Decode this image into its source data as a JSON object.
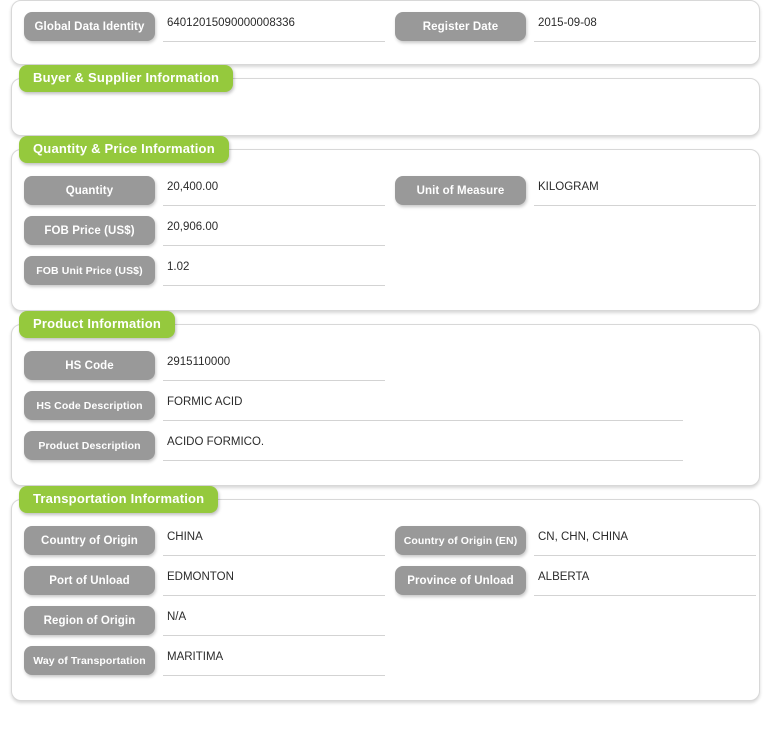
{
  "identity": {
    "fields": [
      {
        "label": "Global Data Identity",
        "value": "64012015090000008336"
      },
      {
        "label": "Register Date",
        "value": "2015-09-08"
      }
    ]
  },
  "sections": [
    {
      "title": "Buyer & Supplier Information",
      "rows": []
    },
    {
      "title": "Quantity & Price Information",
      "rows": [
        {
          "left": {
            "label": "Quantity",
            "value": "20,400.00"
          },
          "right": {
            "label": "Unit of Measure",
            "value": "KILOGRAM"
          }
        },
        {
          "left": {
            "label": "FOB Price (US$)",
            "value": "20,906.00"
          },
          "right": null
        },
        {
          "left": {
            "label": "FOB Unit Price (US$)",
            "value": "1.02"
          },
          "right": null
        }
      ]
    },
    {
      "title": "Product Information",
      "rows": [
        {
          "left": {
            "label": "HS Code",
            "value": "2915110000"
          },
          "right": null
        },
        {
          "left": {
            "label": "HS Code Description",
            "value": "FORMIC ACID",
            "wide": true
          },
          "right": null
        },
        {
          "left": {
            "label": "Product Description",
            "value": "ACIDO FORMICO.",
            "wide": true
          },
          "right": null
        }
      ]
    },
    {
      "title": "Transportation Information",
      "rows": [
        {
          "left": {
            "label": "Country of Origin",
            "value": "CHINA"
          },
          "right": {
            "label": "Country of Origin (EN)",
            "value": "CN, CHN, CHINA"
          }
        },
        {
          "left": {
            "label": "Port of Unload",
            "value": "EDMONTON"
          },
          "right": {
            "label": "Province of Unload",
            "value": "ALBERTA"
          }
        },
        {
          "left": {
            "label": "Region of Origin",
            "value": "N/A"
          },
          "right": null
        },
        {
          "left": {
            "label": "Way of Transportation",
            "value": "MARITIMA"
          },
          "right": null
        }
      ]
    }
  ],
  "colors": {
    "section_tab_green": "#95c93d",
    "label_pill_gray": "#999999",
    "panel_border": "#d8d8d8",
    "underline": "#d3d3d3",
    "value_text": "#2b2b2b",
    "page_background": "#ffffff"
  }
}
